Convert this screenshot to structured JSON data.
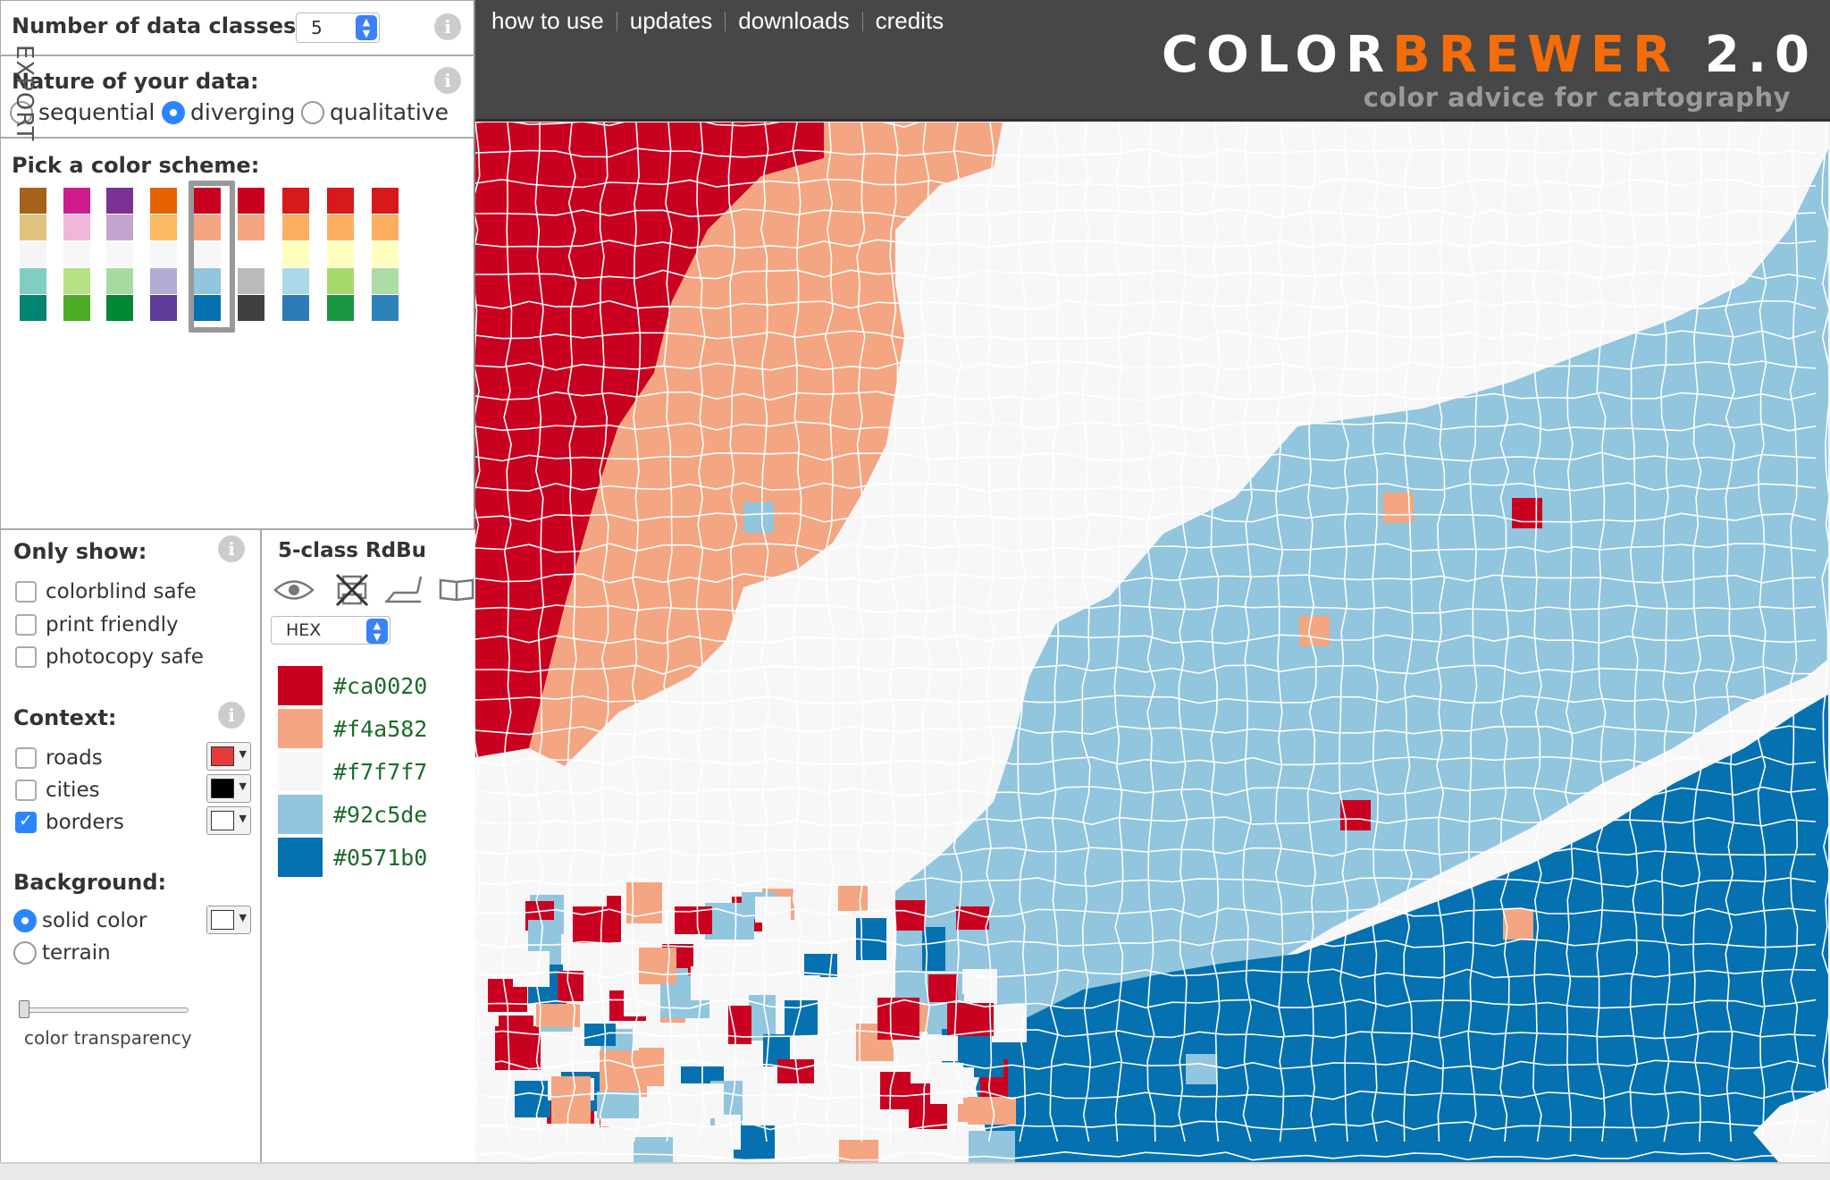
{
  "header": {
    "nav": [
      "how to use",
      "updates",
      "downloads",
      "credits"
    ],
    "brand_part1": "COLOR",
    "brand_part2": "BREWER",
    "brand_part3": " 2.0",
    "subtitle": "color advice for cartography"
  },
  "classes": {
    "label": "Number of data classes:",
    "value": "5"
  },
  "nature": {
    "label": "Nature of your data:",
    "options": [
      "sequential",
      "diverging",
      "qualitative"
    ],
    "selected": "diverging"
  },
  "scheme": {
    "label": "Pick a color scheme:",
    "selected_index": 4,
    "schemes": [
      [
        "#a6611a",
        "#dfc27d",
        "#f5f5f5",
        "#80cdc1",
        "#018571"
      ],
      [
        "#d01c8b",
        "#f1b6da",
        "#f7f7f7",
        "#b8e186",
        "#4dac26"
      ],
      [
        "#7b3294",
        "#c2a5cf",
        "#f7f7f7",
        "#a6dba0",
        "#008837"
      ],
      [
        "#e66101",
        "#fdb863",
        "#f7f7f7",
        "#b2abd2",
        "#5e3c99"
      ],
      [
        "#ca0020",
        "#f4a582",
        "#f7f7f7",
        "#92c5de",
        "#0571b0"
      ],
      [
        "#ca0020",
        "#f4a582",
        "#ffffff",
        "#bababa",
        "#404040"
      ],
      [
        "#d7191c",
        "#fdae61",
        "#ffffbf",
        "#abd9e9",
        "#2c7bb6"
      ],
      [
        "#d7191c",
        "#fdae61",
        "#ffffbf",
        "#a6d96a",
        "#1a9641"
      ],
      [
        "#d7191c",
        "#fdae61",
        "#ffffbf",
        "#abdda4",
        "#2b83ba"
      ]
    ]
  },
  "filters": {
    "only_show_label": "Only show:",
    "items": [
      {
        "label": "colorblind safe",
        "checked": false
      },
      {
        "label": "print friendly",
        "checked": false
      },
      {
        "label": "photocopy safe",
        "checked": false
      }
    ]
  },
  "context": {
    "label": "Context:",
    "items": [
      {
        "label": "roads",
        "checked": false,
        "color": "#e83a3a"
      },
      {
        "label": "cities",
        "checked": false,
        "color": "#000000"
      },
      {
        "label": "borders",
        "checked": true,
        "color": "#ffffff"
      }
    ]
  },
  "background": {
    "label": "Background:",
    "options": [
      {
        "label": "solid color",
        "selected": true,
        "color": "#ffffff"
      },
      {
        "label": "terrain",
        "selected": false
      }
    ],
    "transparency_label": "color transparency",
    "transparency_value": 0
  },
  "legend": {
    "title": "5-class RdBu",
    "format": "HEX",
    "colors": [
      "#ca0020",
      "#f4a582",
      "#f7f7f7",
      "#92c5de",
      "#0571b0"
    ],
    "hex_labels": [
      "#ca0020",
      "#f4a582",
      "#f7f7f7",
      "#92c5de",
      "#0571b0"
    ],
    "export_label": "EXPORT",
    "icons": [
      "eye-icon",
      "no-print-icon",
      "photocopy-icon",
      "lcd-icon"
    ]
  }
}
